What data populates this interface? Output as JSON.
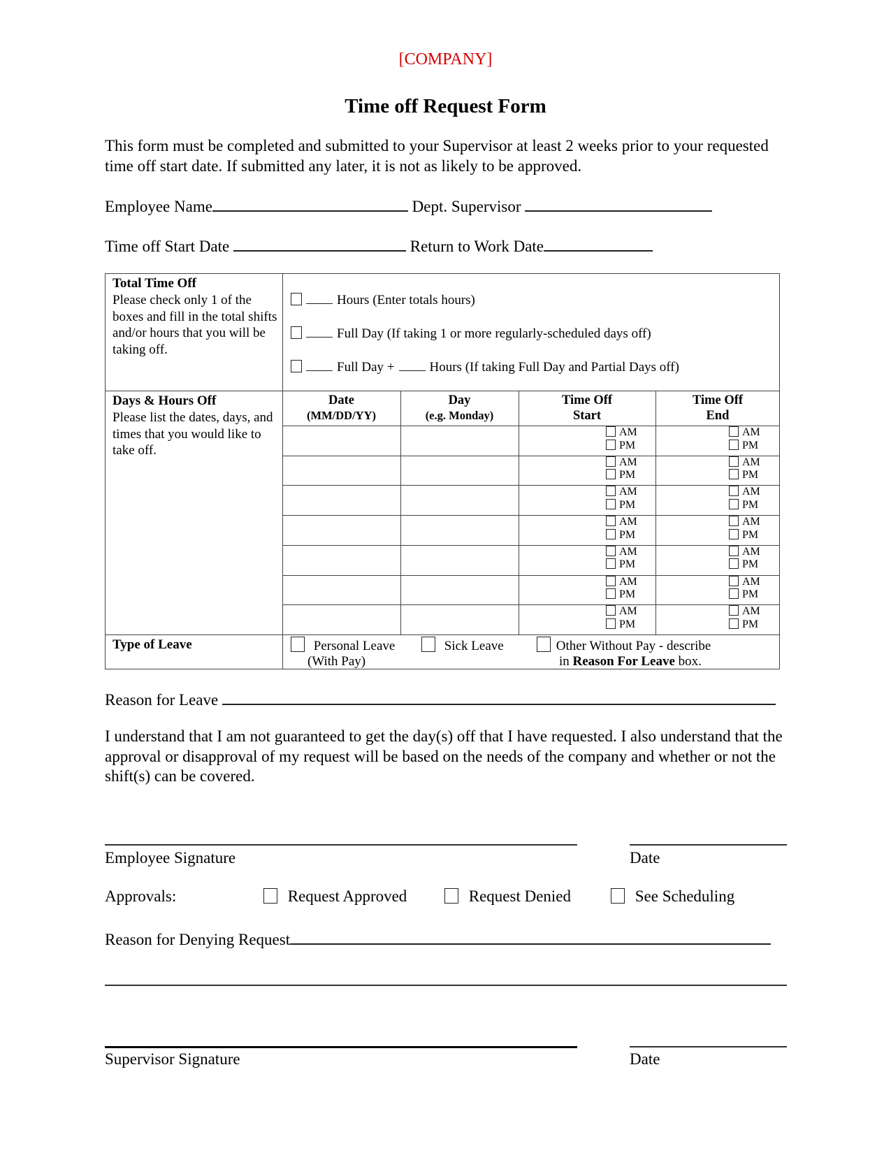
{
  "header": {
    "company": "[COMPANY]",
    "company_color": "#d40000",
    "title": "Time off Request Form"
  },
  "intro": "This form must be completed and submitted to your Supervisor at least 2 weeks prior to your requested time off start date.  If submitted any later, it is not as likely to be approved.",
  "fields": {
    "employee_name": {
      "label": "Employee Name",
      "value": ""
    },
    "dept_supervisor": {
      "label": "Dept. Supervisor",
      "value": ""
    },
    "start_date": {
      "label": "Time off Start Date",
      "value": ""
    },
    "return_date": {
      "label": "Return to Work Date",
      "value": ""
    }
  },
  "total_time_off": {
    "heading": "Total Time Off",
    "instructions": "Please check only 1 of the boxes and fill in the total shifts and/or hours that you will be taking off.",
    "options": [
      {
        "label": "Hours (Enter totals hours)",
        "checked": false
      },
      {
        "label": "Full Day  (If taking 1 or more regularly-scheduled days off)",
        "checked": false
      },
      {
        "label_a": "Full Day +",
        "label_b": "Hours (If taking Full Day and Partial Days off)",
        "checked": false
      }
    ]
  },
  "days_hours_off": {
    "heading": "Days & Hours Off",
    "instructions": "Please list the dates, days, and times that you would like to take off.",
    "columns": [
      {
        "line1": "Date",
        "line2": "(MM/DD/YY)"
      },
      {
        "line1": "Day",
        "line2": "(e.g. Monday)"
      },
      {
        "line1": "Time Off",
        "line2": "Start"
      },
      {
        "line1": "Time Off",
        "line2": "End"
      }
    ],
    "am_label": "AM",
    "pm_label": "PM",
    "rows": [
      {
        "date": "",
        "day": ""
      },
      {
        "date": "",
        "day": ""
      },
      {
        "date": "",
        "day": ""
      },
      {
        "date": "",
        "day": ""
      },
      {
        "date": "",
        "day": ""
      },
      {
        "date": "",
        "day": ""
      },
      {
        "date": "",
        "day": ""
      }
    ]
  },
  "type_of_leave": {
    "heading": "Type of Leave",
    "personal_line1": "Personal Leave",
    "personal_line2": "(With Pay)",
    "sick": "Sick Leave",
    "other_line1": "Other Without Pay - describe",
    "other_line2_pre": "in ",
    "other_line2_bold": "Reason For Leave",
    "other_line2_post": " box."
  },
  "reason_for_leave": {
    "label": "Reason for Leave",
    "value": ""
  },
  "acknowledgement": "I understand that I am not guaranteed to get the day(s) off that I have requested. I also understand that the approval or disapproval of my request will be based on the needs of the company and whether or not the shift(s) can be covered.",
  "employee_signature_label": "Employee Signature",
  "date_label": "Date",
  "approvals": {
    "label": "Approvals:",
    "options": [
      "Request Approved",
      "Request Denied",
      "See Scheduling"
    ]
  },
  "reason_for_denying": {
    "label": "Reason for Denying Request",
    "value": ""
  },
  "supervisor_signature_label": "Supervisor Signature"
}
